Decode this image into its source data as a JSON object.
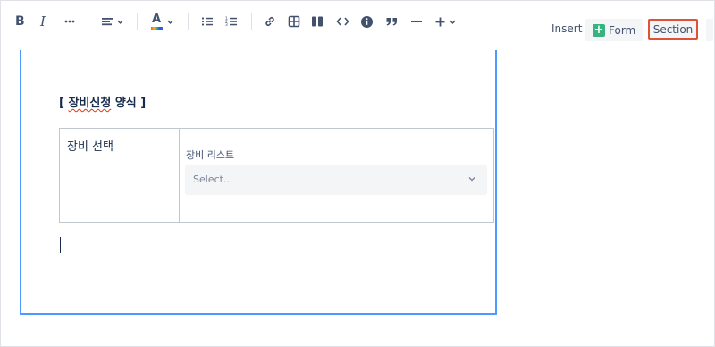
{
  "toolbar": {
    "bold_icon": "B",
    "italic_icon": "I",
    "more_icon": "more-icon",
    "align_icon": "align-left-icon",
    "text_color_icon": "A",
    "bullet_list_icon": "bullet-list-icon",
    "numbered_list_icon": "numbered-list-icon",
    "link_icon": "link-icon",
    "table_icon": "table-icon",
    "layout_icon": "layout-columns-icon",
    "code_icon": "<>",
    "info_icon": "info-icon",
    "quote_icon": "quote-icon",
    "divider_icon": "divider-icon",
    "insert_plus_icon": "plus-icon",
    "insert_label": "Insert",
    "form_button": "Form",
    "section_button": "Section"
  },
  "editor": {
    "heading": "[ 장비신청 양식 ]",
    "heading_misspelled": "장비신청",
    "table": {
      "left_cell": "장비 선택",
      "field_label": "장비 리스트",
      "select_placeholder": "Select..."
    }
  },
  "colors": {
    "accent_border": "#4c9aff",
    "section_highlight": "#e0513a",
    "form_plus": "#36b37e"
  }
}
